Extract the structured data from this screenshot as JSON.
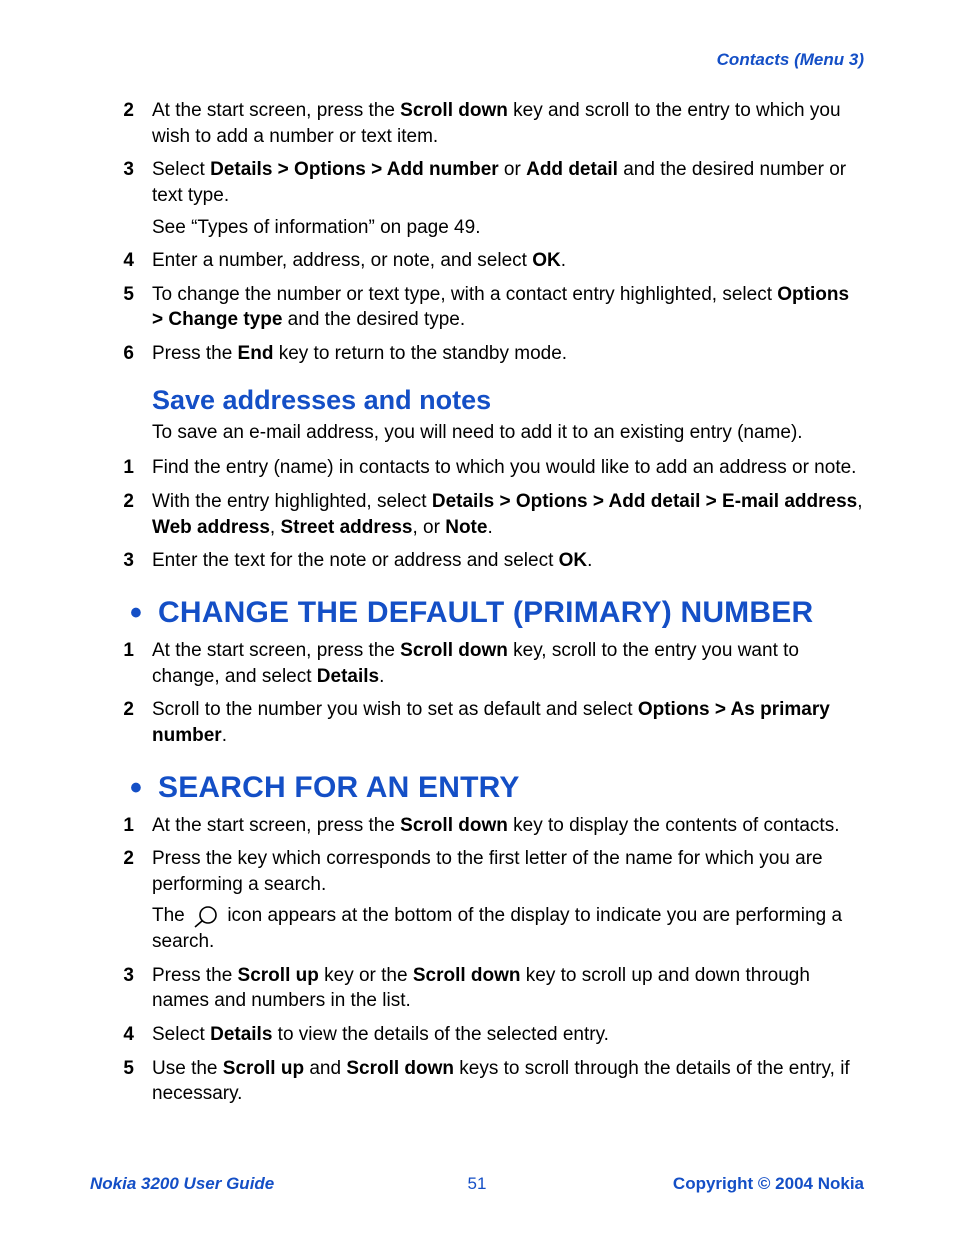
{
  "header": {
    "breadcrumb": "Contacts (Menu 3)"
  },
  "list1": {
    "2": {
      "a": "At the start screen, press the ",
      "b": "Scroll down",
      "c": " key and scroll to the entry to which you wish to add a number or text item."
    },
    "3": {
      "a": "Select ",
      "b": "Details > Options > Add number",
      "c": " or ",
      "d": "Add detail",
      "e": " and the desired number or text type.",
      "sub": "See “Types of information” on page 49."
    },
    "4": {
      "a": "Enter a number, address, or note, and select ",
      "b": "OK",
      "c": "."
    },
    "5": {
      "a": "To change the number or text type, with a contact entry highlighted, select ",
      "b": "Options > Change type",
      "c": " and the desired type."
    },
    "6": {
      "a": "Press the ",
      "b": "End",
      "c": " key to return to the standby mode."
    }
  },
  "section_save": {
    "heading": "Save addresses and notes",
    "intro": "To save an e-mail address, you will need to add it to an existing entry (name).",
    "items": {
      "1": {
        "a": "Find the entry (name) in contacts to which you would like to add an address or note."
      },
      "2": {
        "a": "With the entry highlighted, select ",
        "b": "Details > Options > Add detail > E-mail address",
        "c": ", ",
        "d": "Web address",
        "e": ", ",
        "f": "Street address",
        "g": ", or ",
        "h": "Note",
        "i": "."
      },
      "3": {
        "a": "Enter the text for the note or address and select ",
        "b": "OK",
        "c": "."
      }
    }
  },
  "section_primary": {
    "heading": "CHANGE THE DEFAULT (PRIMARY) NUMBER",
    "items": {
      "1": {
        "a": "At the start screen, press the ",
        "b": "Scroll down",
        "c": " key, scroll to the entry you want to change, and select ",
        "d": "Details",
        "e": "."
      },
      "2": {
        "a": "Scroll to the number you wish to set as default and select ",
        "b": "Options > As primary number",
        "c": "."
      }
    }
  },
  "section_search": {
    "heading": "SEARCH FOR AN ENTRY",
    "items": {
      "1": {
        "a": "At the start screen, press the ",
        "b": "Scroll down",
        "c": " key to display the contents of contacts."
      },
      "2": {
        "a": "Press the key which corresponds to the first letter of the name for which you are performing a search.",
        "sub_a": "The ",
        "sub_b": " icon appears at the bottom of the display to indicate you are performing a search."
      },
      "3": {
        "a": "Press the ",
        "b": "Scroll up",
        "c": " key or the ",
        "d": "Scroll down",
        "e": " key to scroll up and down through names and numbers in the list."
      },
      "4": {
        "a": "Select ",
        "b": "Details",
        "c": " to view the details of the selected entry."
      },
      "5": {
        "a": "Use the ",
        "b": "Scroll up",
        "c": " and ",
        "d": "Scroll down",
        "e": " keys to scroll through the details of the entry, if necessary."
      }
    }
  },
  "footer": {
    "left": "Nokia 3200 User Guide",
    "center": "51",
    "right": "Copyright © 2004 Nokia"
  }
}
